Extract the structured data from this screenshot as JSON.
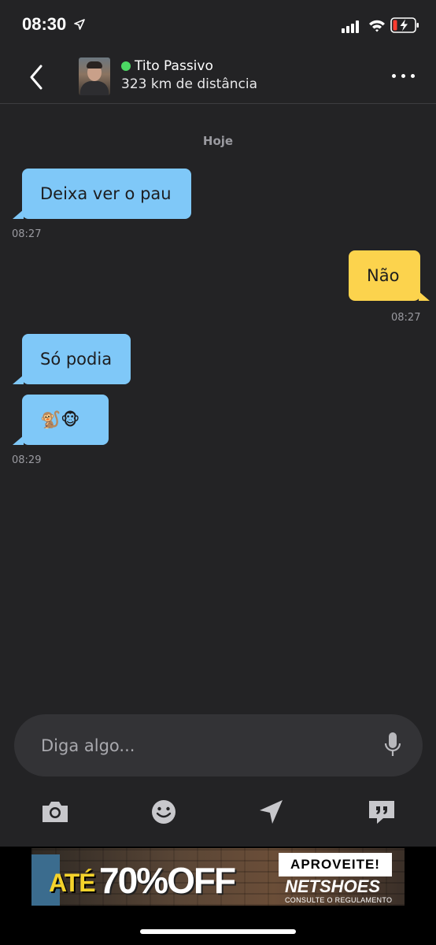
{
  "status_bar": {
    "time": "08:30"
  },
  "header": {
    "contact_name": "Tito Passivo",
    "distance": "323 km de distância",
    "online_color": "#4cd964"
  },
  "conversation": {
    "date_divider": "Hoje",
    "messages": [
      {
        "direction": "incoming",
        "text": "Deixa ver o pau"
      },
      {
        "direction": "incoming",
        "time": "08:27"
      },
      {
        "direction": "outgoing",
        "text": "Não",
        "time": "08:27"
      },
      {
        "direction": "incoming",
        "text": "Só podia"
      },
      {
        "direction": "incoming",
        "text": "🐒🐵",
        "time": "08:29"
      }
    ],
    "incoming_color": "#7fc8f8",
    "outgoing_color": "#fcd34d"
  },
  "composer": {
    "placeholder": "Diga algo..."
  },
  "toolbar": {
    "icons": [
      "camera-icon",
      "emoji-icon",
      "location-icon",
      "quote-icon"
    ]
  },
  "ad": {
    "prefix": "ATÉ",
    "headline": "70%OFF",
    "cta": "APROVEITE!",
    "brand": "NETSHOES",
    "note": "CONSULTE O REGULAMENTO"
  }
}
